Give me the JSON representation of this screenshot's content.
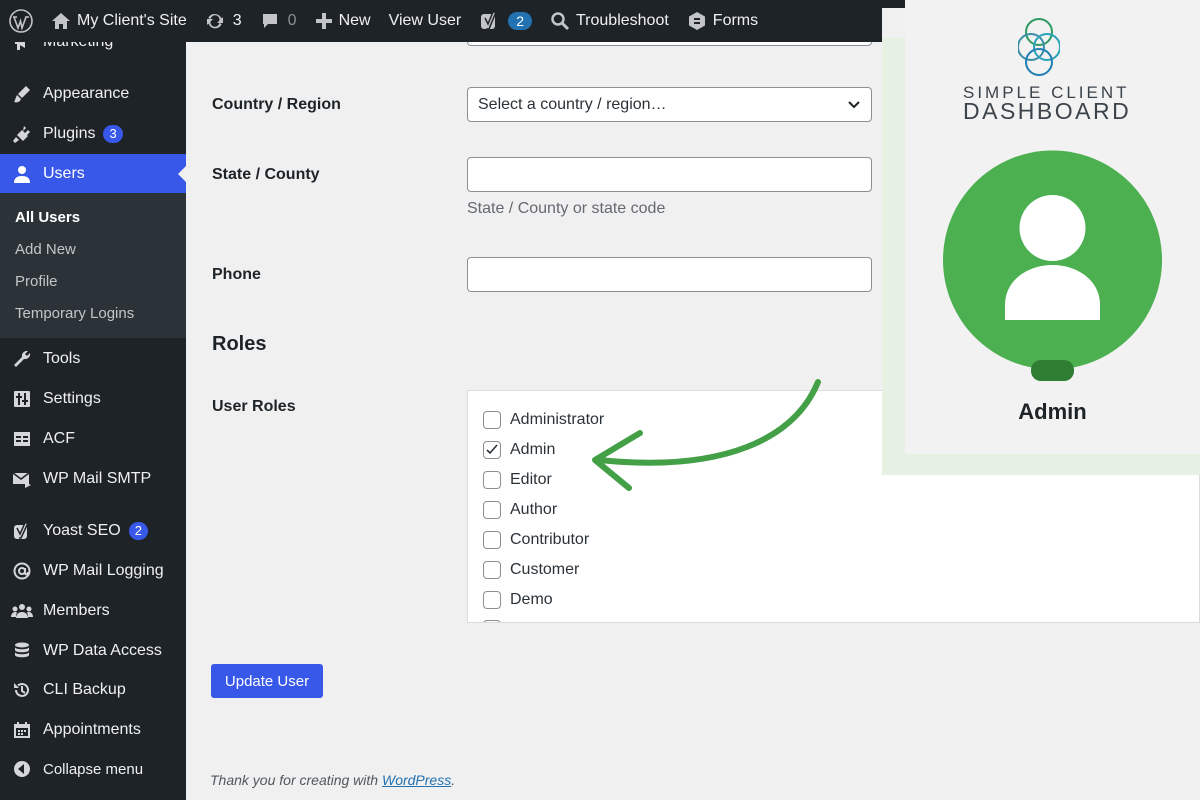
{
  "admin_bar": {
    "site_name": "My Client's Site",
    "updates_count": "3",
    "comments_count": "0",
    "new_label": "New",
    "view_user_label": "View User",
    "yoast_badge": "2",
    "troubleshoot_label": "Troubleshoot",
    "forms_label": "Forms"
  },
  "sidebar": {
    "items": [
      {
        "label": "Marketing",
        "icon": "megaphone-icon"
      },
      {
        "label": "Appearance",
        "icon": "paintbrush-icon"
      },
      {
        "label": "Plugins",
        "icon": "plugin-icon",
        "badge": "3"
      },
      {
        "label": "Users",
        "icon": "user-icon",
        "current": true
      },
      {
        "label": "Tools",
        "icon": "wrench-icon"
      },
      {
        "label": "Settings",
        "icon": "settings-sliders-icon"
      },
      {
        "label": "ACF",
        "icon": "table-icon"
      },
      {
        "label": "WP Mail SMTP",
        "icon": "mail-icon"
      },
      {
        "label": "Yoast SEO",
        "icon": "yoast-icon",
        "badge": "2"
      },
      {
        "label": "WP Mail Logging",
        "icon": "at-sign-icon"
      },
      {
        "label": "Members",
        "icon": "groups-icon"
      },
      {
        "label": "WP Data Access",
        "icon": "database-icon"
      },
      {
        "label": "CLI Backup",
        "icon": "backup-icon"
      },
      {
        "label": "Appointments",
        "icon": "calendar-icon"
      },
      {
        "label": "Collapse menu",
        "icon": "collapse-icon"
      }
    ],
    "submenu": [
      {
        "label": "All Users",
        "active": true
      },
      {
        "label": "Add New"
      },
      {
        "label": "Profile"
      },
      {
        "label": "Temporary Logins"
      }
    ]
  },
  "form": {
    "country_label": "Country / Region",
    "country_placeholder": "Select a country / region…",
    "state_label": "State / County",
    "state_value": "",
    "state_hint": "State / County or state code",
    "phone_label": "Phone",
    "phone_value": "",
    "roles_heading": "Roles",
    "user_roles_label": "User Roles",
    "roles": [
      {
        "label": "Administrator",
        "checked": false
      },
      {
        "label": "Admin",
        "checked": true
      },
      {
        "label": "Editor",
        "checked": false
      },
      {
        "label": "Author",
        "checked": false
      },
      {
        "label": "Contributor",
        "checked": false
      },
      {
        "label": "Customer",
        "checked": false
      },
      {
        "label": "Demo",
        "checked": false
      }
    ],
    "submit_label": "Update User"
  },
  "footer": {
    "text": "Thank you for creating with ",
    "link": "WordPress",
    "suffix": "."
  },
  "overlay": {
    "brand_line1": "SIMPLE CLIENT",
    "brand_line2": "DASHBOARD",
    "avatar_role": "Admin",
    "colors": {
      "accent_green": "#4caf50",
      "arrow_green": "#43a047",
      "wp_blue": "#3858e9"
    }
  }
}
